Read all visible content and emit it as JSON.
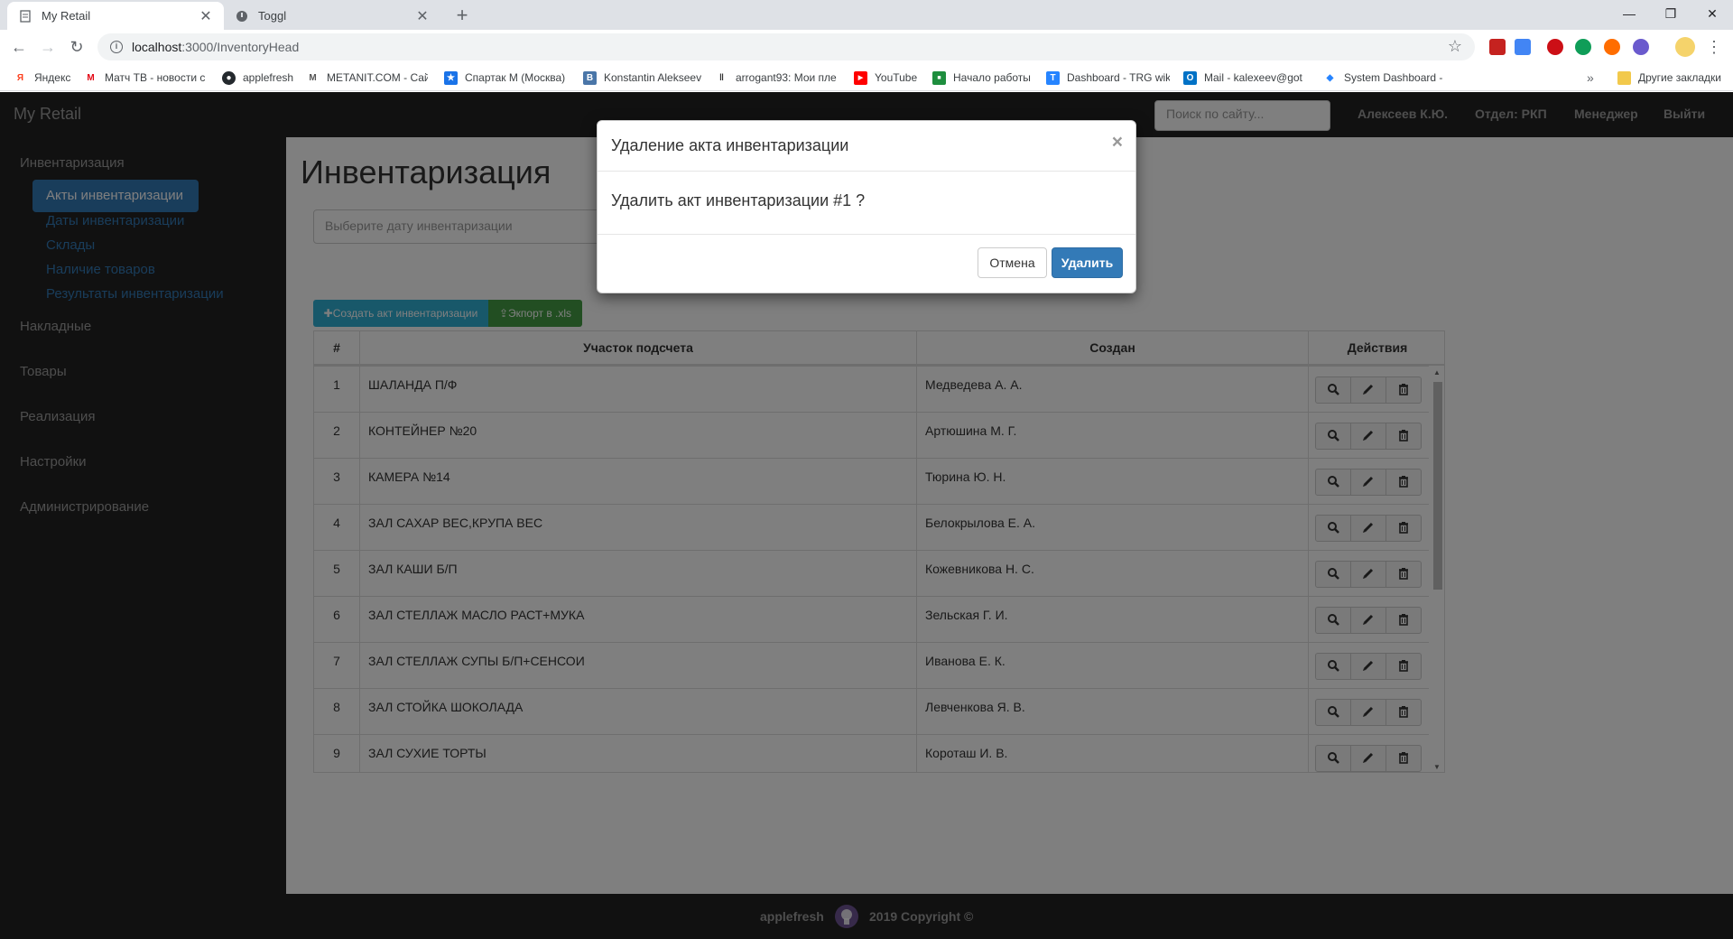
{
  "browser": {
    "tabs": [
      {
        "title": "My Retail",
        "active": true
      },
      {
        "title": "Toggl",
        "active": false
      }
    ],
    "url_host": "localhost",
    "url_path": ":3000/InventoryHead",
    "bookmarks": [
      {
        "label": "Яндекс",
        "icon_color": "#fc3f1d",
        "icon": "Я"
      },
      {
        "label": "Матч ТВ - новости с",
        "icon_color": "#e30613",
        "icon": "M"
      },
      {
        "label": "applefresh",
        "icon_color": "#24292e",
        "icon": "●"
      },
      {
        "label": "METANIT.COM - Сай",
        "icon_color": "#555555",
        "icon": "M"
      },
      {
        "label": "Спартак М (Москва)",
        "icon_color": "#1a73e8",
        "icon": "★"
      },
      {
        "label": "Konstantin Alekseev",
        "icon_color": "#4a76a8",
        "icon": "В"
      },
      {
        "label": "arrogant93: Мои пле",
        "icon_color": "#333333",
        "icon": "ǁ"
      },
      {
        "label": "YouTube",
        "icon_color": "#ff0000",
        "icon": "▶"
      },
      {
        "label": "Начало работы",
        "icon_color": "#1e8e3e",
        "icon": "■"
      },
      {
        "label": "Dashboard - TRG wik",
        "icon_color": "#2684ff",
        "icon": "T"
      },
      {
        "label": "Mail - kalexeev@got",
        "icon_color": "#0072c6",
        "icon": "O"
      },
      {
        "label": "System Dashboard -",
        "icon_color": "#2684ff",
        "icon": "◆"
      }
    ],
    "other_bookmarks": "Другие закладки"
  },
  "app": {
    "brand": "My Retail",
    "search_placeholder": "Поиск по сайту...",
    "user": "Алексеев К.Ю.",
    "department": "Отдел: РКП",
    "role": "Менеджер",
    "logout": "Выйти"
  },
  "sidebar": {
    "sections": [
      {
        "label": "Инвентаризация"
      },
      {
        "label": "Накладные"
      },
      {
        "label": "Товары"
      },
      {
        "label": "Реализация"
      },
      {
        "label": "Настройки"
      },
      {
        "label": "Администрирование"
      }
    ],
    "subitems": [
      {
        "label": "Акты инвентаризации",
        "active": true
      },
      {
        "label": "Даты инвентаризации"
      },
      {
        "label": "Склады"
      },
      {
        "label": "Наличие товаров"
      },
      {
        "label": "Результаты инвентаризации"
      }
    ]
  },
  "main": {
    "title": "Инвентаризация",
    "date_placeholder": "Выберите дату инвентаризации",
    "create_button": "Создать акт инвентаризации",
    "export_button": "Экпорт в .xls",
    "table": {
      "columns": [
        "#",
        "Участок подсчета",
        "Создан",
        "Действия"
      ],
      "rows": [
        {
          "num": "1",
          "area": "ШАЛАНДА П/Ф",
          "created": "Медведева А. А."
        },
        {
          "num": "2",
          "area": "КОНТЕЙНЕР №20",
          "created": "Артюшина М. Г."
        },
        {
          "num": "3",
          "area": "КАМЕРА №14",
          "created": "Тюрина Ю. Н."
        },
        {
          "num": "4",
          "area": "ЗАЛ САХАР ВЕС,КРУПА ВЕС",
          "created": "Белокрылова Е. А."
        },
        {
          "num": "5",
          "area": "ЗАЛ КАШИ Б/П",
          "created": "Кожевникова Н. С."
        },
        {
          "num": "6",
          "area": "ЗАЛ СТЕЛЛАЖ МАСЛО РАСТ+МУКА",
          "created": "Зельская Г. И."
        },
        {
          "num": "7",
          "area": "ЗАЛ СТЕЛЛАЖ СУПЫ Б/П+СЕНСОИ",
          "created": "Иванова Е. К."
        },
        {
          "num": "8",
          "area": "ЗАЛ СТОЙКА ШОКОЛАДА",
          "created": "Левченкова Я. В."
        },
        {
          "num": "9",
          "area": "ЗАЛ СУХИЕ ТОРТЫ",
          "created": "Короташ И. В."
        }
      ]
    }
  },
  "footer": {
    "author": "applefresh",
    "copyright": "2019 Copyright ©"
  },
  "modal": {
    "title": "Удаление акта инвентаризации",
    "close": "×",
    "body": "Удалить акт инвентаризации #1 ?",
    "cancel": "Отмена",
    "confirm": "Удалить"
  }
}
